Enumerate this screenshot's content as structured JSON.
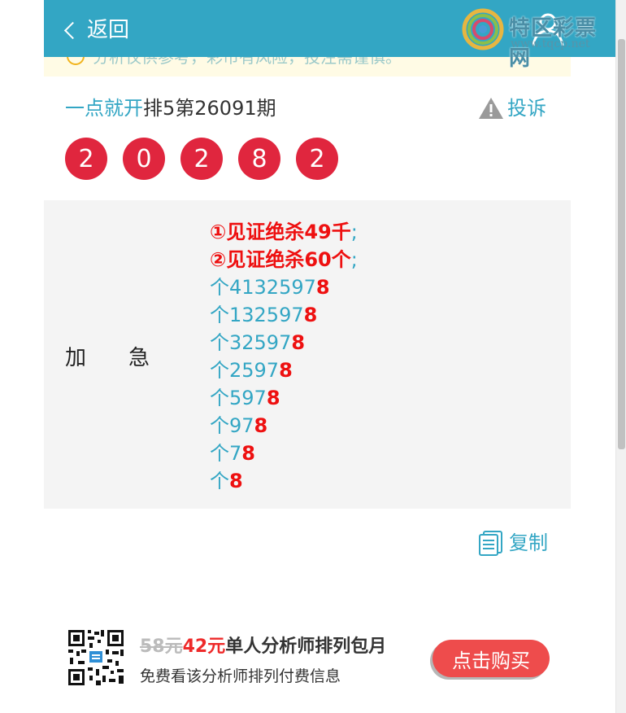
{
  "header": {
    "back_label": "返回"
  },
  "watermark": {
    "title": "特区彩票网",
    "url": "www.tqcp.net"
  },
  "notice": {
    "text": "分析仅供参考，彩市有风险，投注需谨慎。"
  },
  "draw": {
    "title_prefix": "一点就开",
    "title_rest": "排5第26091期",
    "complain_label": "投诉",
    "balls": [
      "2",
      "0",
      "2",
      "8",
      "2"
    ]
  },
  "content": {
    "label_left": "加",
    "label_right": "急",
    "lines": [
      {
        "main": "①见证绝杀49千",
        "suffix": ";"
      },
      {
        "main": "②见证绝杀60个",
        "suffix": ";"
      },
      {
        "prefix": "个4132597",
        "last": "8"
      },
      {
        "prefix": "个132597",
        "last": "8"
      },
      {
        "prefix": "个32597",
        "last": "8"
      },
      {
        "prefix": "个2597",
        "last": "8"
      },
      {
        "prefix": "个597",
        "last": "8"
      },
      {
        "prefix": "个97",
        "last": "8"
      },
      {
        "prefix": "个7",
        "last": "8"
      },
      {
        "prefix": "个",
        "last": "8"
      }
    ]
  },
  "copy_label": "复制",
  "promo": {
    "old_price": "58元",
    "new_price": "42元",
    "title": "单人分析师排列包月",
    "subtitle": "免费看该分析师排列付费信息",
    "buy_label": "点击购买"
  },
  "colors": {
    "header": "#33a6c4",
    "ball": "#e0263e",
    "accent_red": "#ee1010",
    "button": "#ee4c4c"
  }
}
